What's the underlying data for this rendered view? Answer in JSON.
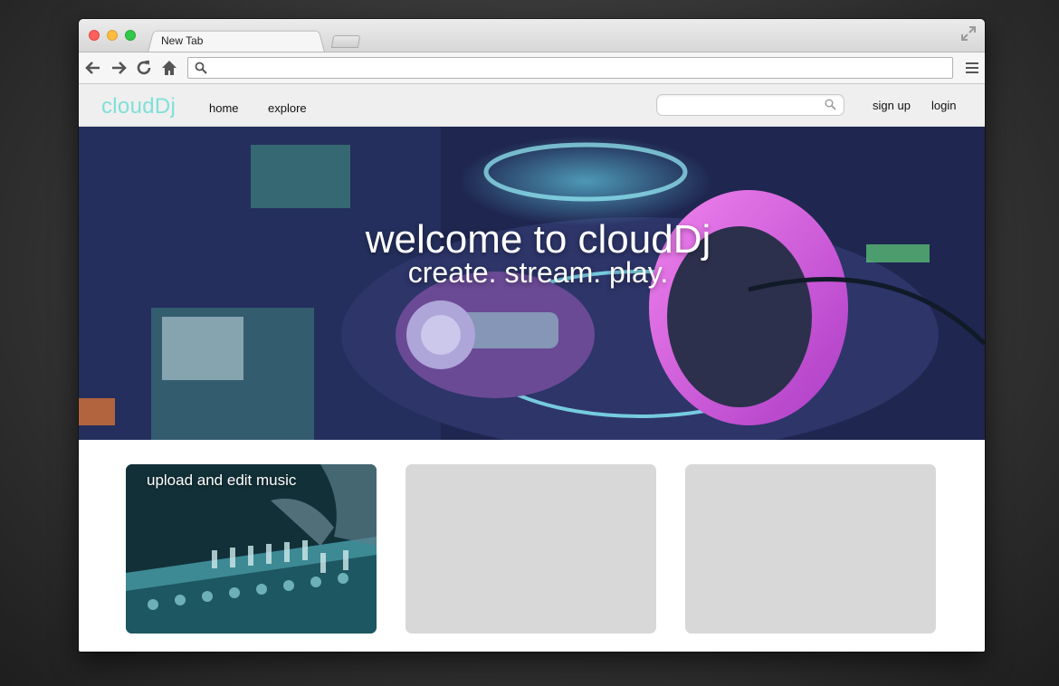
{
  "browser": {
    "tab_title": "New Tab",
    "address_value": ""
  },
  "site": {
    "logo": "cloudDj",
    "nav": {
      "home": "home",
      "explore": "explore"
    },
    "search_value": "",
    "auth": {
      "signup": "sign up",
      "login": "login"
    }
  },
  "hero": {
    "title": "welcome to cloudDj",
    "subtitle": "create. stream. play."
  },
  "cards": [
    {
      "title": "upload and edit music"
    },
    {
      "title": ""
    },
    {
      "title": ""
    }
  ],
  "colors": {
    "logo": "#7fe0d8",
    "card_placeholder": "#d8d8d8"
  }
}
